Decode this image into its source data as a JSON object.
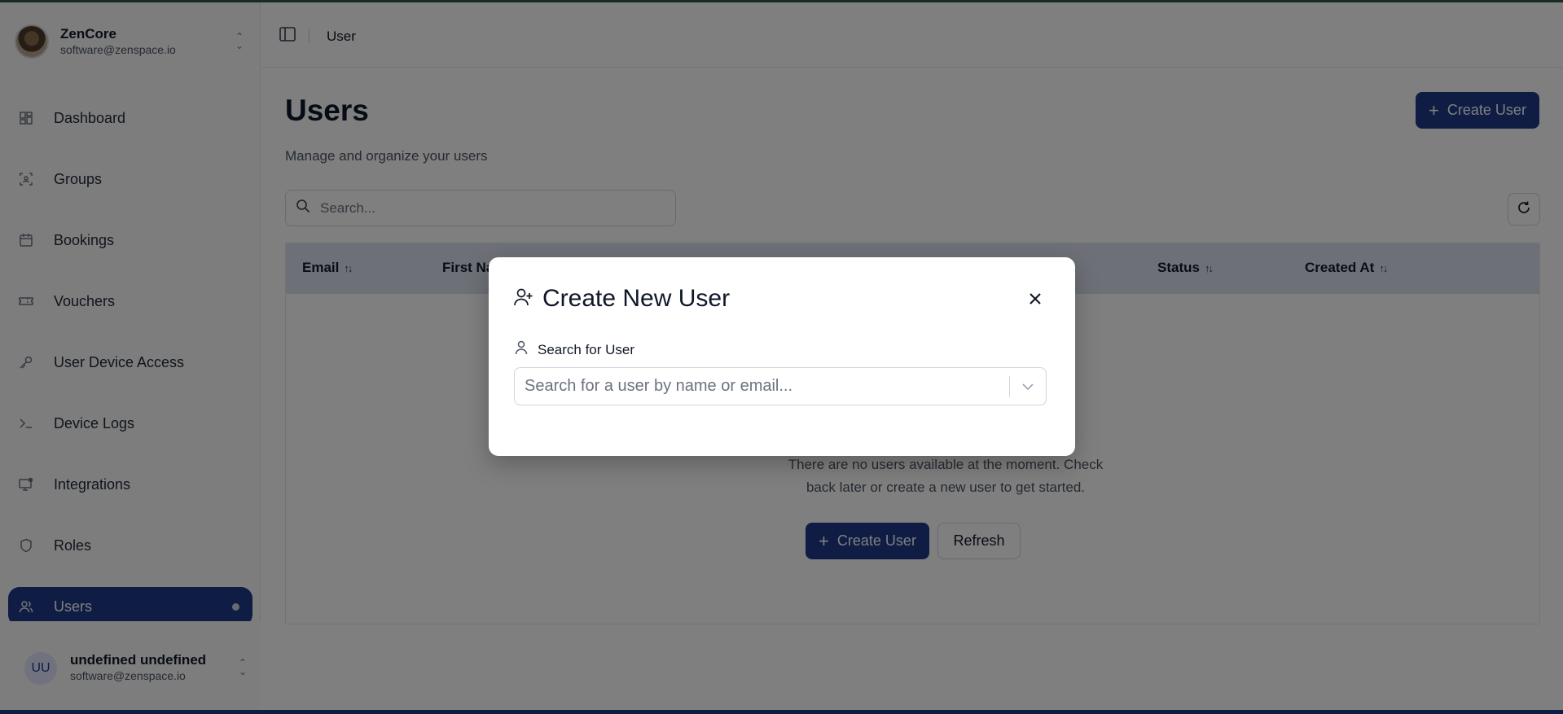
{
  "org": {
    "name": "ZenCore",
    "email": "software@zenspace.io"
  },
  "sidebar": {
    "items": [
      {
        "label": "Dashboard",
        "icon": "dashboard-icon"
      },
      {
        "label": "Groups",
        "icon": "groups-icon"
      },
      {
        "label": "Bookings",
        "icon": "calendar-icon"
      },
      {
        "label": "Vouchers",
        "icon": "ticket-icon"
      },
      {
        "label": "User Device Access",
        "icon": "key-icon"
      },
      {
        "label": "Device Logs",
        "icon": "terminal-icon"
      },
      {
        "label": "Integrations",
        "icon": "monitor-icon"
      },
      {
        "label": "Roles",
        "icon": "shield-icon"
      },
      {
        "label": "Users",
        "icon": "users-icon",
        "active": true
      }
    ]
  },
  "current_user": {
    "initials": "UU",
    "name": "undefined undefined",
    "email": "software@zenspace.io"
  },
  "header": {
    "breadcrumb": "User"
  },
  "page": {
    "title": "Users",
    "subtitle": "Manage and organize your users",
    "create_label": "Create User"
  },
  "search": {
    "placeholder": "Search..."
  },
  "table": {
    "columns": [
      {
        "label": "Email"
      },
      {
        "label": "First Na"
      },
      {
        "label": "Status"
      },
      {
        "label": "Created At"
      }
    ],
    "empty_line1": "There are no users available at the moment. Check",
    "empty_line2": "back later or create a new user to get started.",
    "create_label": "Create User",
    "refresh_label": "Refresh"
  },
  "modal": {
    "title": "Create New User",
    "field_label": "Search for User",
    "combo_placeholder": "Search for a user by name or email..."
  },
  "colors": {
    "primary": "#1e3a8a",
    "table_header": "#dbe2ef",
    "overlay": "rgba(0,0,0,0.5)"
  }
}
